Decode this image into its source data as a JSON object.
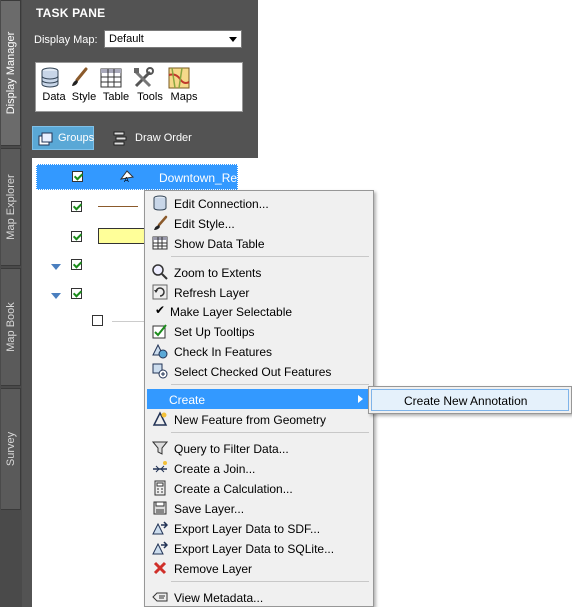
{
  "side_tabs": [
    "Display Manager",
    "Map Explorer",
    "Map Book",
    "Survey"
  ],
  "task_pane": {
    "title": "TASK PANE",
    "display_map_label": "Display Map:",
    "display_map_value": "Default"
  },
  "toolbar": {
    "data": "Data",
    "style": "Style",
    "table": "Table",
    "tools": "Tools",
    "maps": "Maps"
  },
  "view_tabs": {
    "groups": "Groups",
    "draw_order": "Draw Order"
  },
  "layers": [
    {
      "name": "Downtown_Re",
      "checked": true,
      "selected": true
    },
    {
      "name": "",
      "checked": true
    },
    {
      "name": "",
      "checked": true
    },
    {
      "name": "",
      "checked": true,
      "expanded": true
    },
    {
      "name": "",
      "checked": true,
      "expanded": true
    },
    {
      "name": "",
      "checked": false
    }
  ],
  "context_menu": {
    "edit_connection": "Edit Connection...",
    "edit_style": "Edit Style...",
    "show_data_table": "Show Data Table",
    "zoom_to_extents": "Zoom to Extents",
    "refresh_layer": "Refresh Layer",
    "make_layer_selectable": "Make Layer Selectable",
    "set_up_tooltips": "Set Up Tooltips",
    "check_in_features": "Check In Features",
    "select_checked_out": "Select Checked Out Features",
    "create": "Create",
    "new_feature_from_geometry": "New Feature from Geometry",
    "query_to_filter": "Query to Filter Data...",
    "create_join": "Create a Join...",
    "create_calculation": "Create a Calculation...",
    "save_layer": "Save Layer...",
    "export_sdf": "Export Layer Data to SDF...",
    "export_sqlite": "Export Layer Data to SQLite...",
    "remove_layer": "Remove Layer",
    "view_metadata": "View Metadata..."
  },
  "submenu": {
    "create_new_annotation": "Create New Annotation"
  },
  "colors": {
    "selection": "#3399ff",
    "pane_bg": "#535353",
    "menu_bg": "#f0f0f0"
  }
}
